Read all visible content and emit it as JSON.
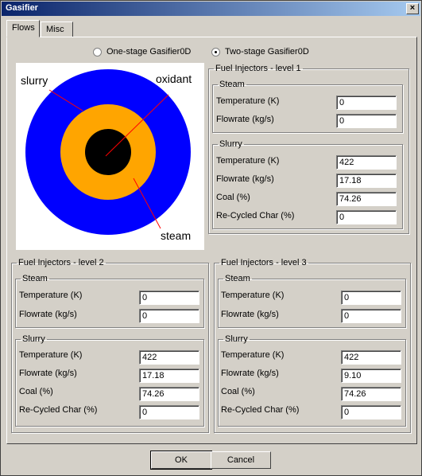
{
  "window": {
    "title": "Gasifier",
    "close_glyph": "×"
  },
  "tabs": [
    {
      "label": "Flows"
    },
    {
      "label": "Misc"
    }
  ],
  "mode": {
    "one_stage_label": "One-stage Gasifier0D",
    "two_stage_label": "Two-stage Gasifier0D",
    "selected": "two-stage"
  },
  "diagram": {
    "labels": {
      "slurry": "slurry",
      "oxidant": "oxidant",
      "steam": "steam"
    },
    "colors": {
      "outer": "#0000ff",
      "middle": "#ffa500",
      "inner": "#000000",
      "pointer": "#ff0000"
    }
  },
  "level1": {
    "title": "Fuel Injectors - level 1",
    "steam": {
      "title": "Steam",
      "temperature_label": "Temperature (K)",
      "temperature": "0",
      "flowrate_label": "Flowrate (kg/s)",
      "flowrate": "0"
    },
    "slurry": {
      "title": "Slurry",
      "temperature_label": "Temperature (K)",
      "temperature": "422",
      "flowrate_label": "Flowrate (kg/s)",
      "flowrate": "17.18",
      "coal_label": "Coal (%)",
      "coal": "74.26",
      "char_label": "Re-Cycled Char (%)",
      "char": "0"
    }
  },
  "level2": {
    "title": "Fuel Injectors - level 2",
    "steam": {
      "title": "Steam",
      "temperature_label": "Temperature (K)",
      "temperature": "0",
      "flowrate_label": "Flowrate (kg/s)",
      "flowrate": "0"
    },
    "slurry": {
      "title": "Slurry",
      "temperature_label": "Temperature (K)",
      "temperature": "422",
      "flowrate_label": "Flowrate (kg/s)",
      "flowrate": "17.18",
      "coal_label": "Coal (%)",
      "coal": "74.26",
      "char_label": "Re-Cycled Char (%)",
      "char": "0"
    }
  },
  "level3": {
    "title": "Fuel Injectors - level 3",
    "steam": {
      "title": "Steam",
      "temperature_label": "Temperature (K)",
      "temperature": "0",
      "flowrate_label": "Flowrate (kg/s)",
      "flowrate": "0"
    },
    "slurry": {
      "title": "Slurry",
      "temperature_label": "Temperature (K)",
      "temperature": "422",
      "flowrate_label": "Flowrate (kg/s)",
      "flowrate": "9.10",
      "coal_label": "Coal (%)",
      "coal": "74.26",
      "char_label": "Re-Cycled Char (%)",
      "char": "0"
    }
  },
  "buttons": {
    "ok": "OK",
    "cancel": "Cancel"
  }
}
